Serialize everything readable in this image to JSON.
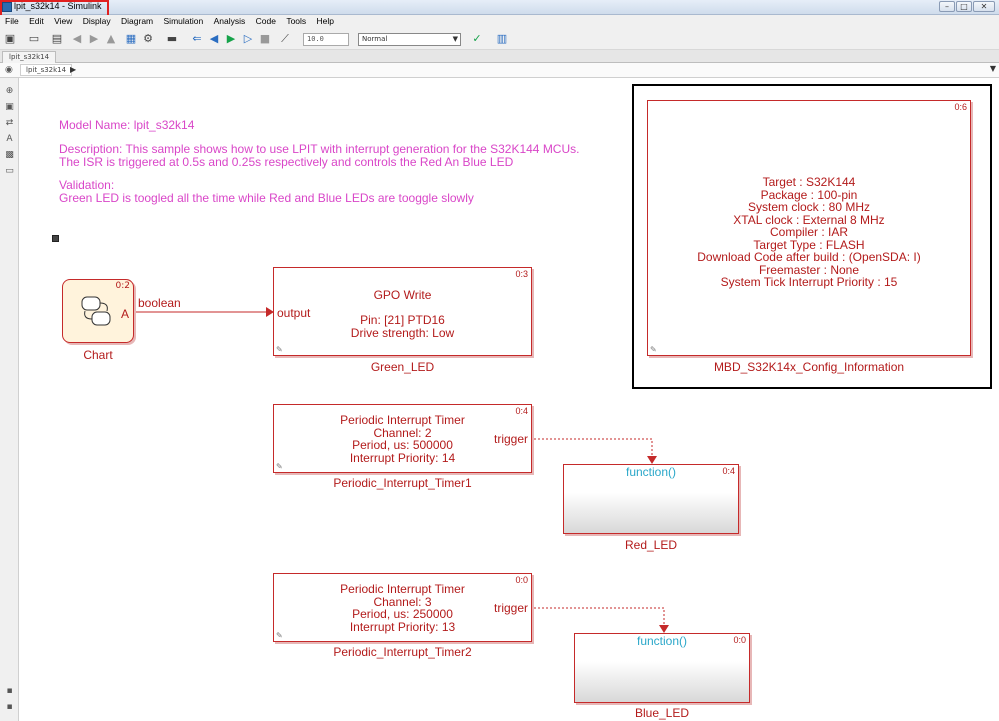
{
  "window": {
    "title": "lpit_s32k14 - Simulink",
    "controls": [
      "–",
      "□",
      "✕"
    ]
  },
  "menu": [
    "File",
    "Edit",
    "View",
    "Display",
    "Diagram",
    "Simulation",
    "Analysis",
    "Code",
    "Tools",
    "Help"
  ],
  "toolbar": {
    "stop_time": "10.0",
    "sim_mode": "Normal"
  },
  "tabs": [
    "lpit_s32k14"
  ],
  "breadcrumb": [
    "lpit_s32k14"
  ],
  "annotation": {
    "model_name": "Model Name: lpit_s32k14",
    "description": "Description: This sample shows how to use LPIT with interrupt generation for the S32K144 MCUs.\nThe ISR is triggered at 0.5s and 0.25s respectively and controls the Red An Blue LED",
    "validation": "Validation:\nGreen LED is toogled all the time while Red and Blue LEDs are tooggle slowly"
  },
  "blocks": {
    "chart": {
      "name": "Chart",
      "id": "0:2",
      "state_label": "A",
      "out_signal": "boolean"
    },
    "green_led": {
      "name": "Green_LED",
      "id": "0:3",
      "port": "output",
      "text": "GPO Write\n\nPin: [21] PTD16\nDrive strength: Low"
    },
    "config": {
      "name": "MBD_S32K14x_Config_Information",
      "id": "0:6",
      "text": "Target : S32K144\nPackage : 100-pin\nSystem clock : 80 MHz\nXTAL clock : External 8 MHz\nCompiler : IAR\nTarget Type : FLASH\nDownload Code after build : (OpenSDA: I)\nFreemaster : None\nSystem Tick Interrupt Priority : 15"
    },
    "pit1": {
      "name": "Periodic_Interrupt_Timer1",
      "id": "0:4",
      "port": "trigger",
      "text": "Periodic Interrupt Timer\nChannel: 2\nPeriod, us: 500000\nInterrupt Priority: 14"
    },
    "red_led": {
      "name": "Red_LED",
      "id": "0:4",
      "function_label": "function()"
    },
    "pit2": {
      "name": "Periodic_Interrupt_Timer2",
      "id": "0:0",
      "port": "trigger",
      "text": "Periodic Interrupt Timer\nChannel: 3\nPeriod, us: 250000\nInterrupt Priority: 13"
    },
    "blue_led": {
      "name": "Blue_LED",
      "id": "0:0",
      "function_label": "function()"
    }
  },
  "colors": {
    "block": "#c52a2a",
    "annotation": "#d946c8",
    "function_label": "#2aa7c9",
    "highlight": "#e02020"
  }
}
